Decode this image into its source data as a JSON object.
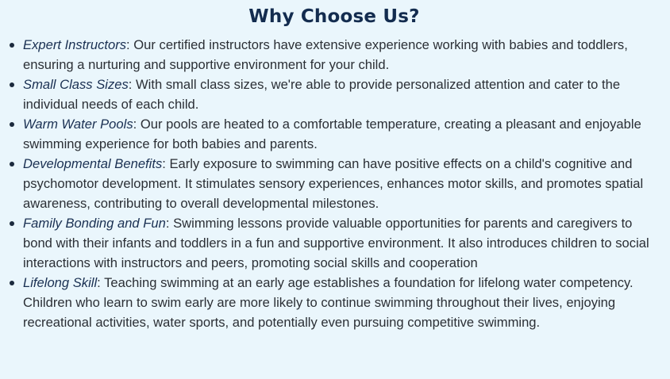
{
  "heading": "Why Choose Us?",
  "items": [
    {
      "term": "Expert Instructors",
      "text": ": Our certified instructors have extensive experience working with babies and toddlers, ensuring a nurturing and supportive environment for your child."
    },
    {
      "term": "Small Class Sizes",
      "text": ": With small class sizes, we're able to provide personalized attention and cater to the individual needs of each child."
    },
    {
      "term": "Warm Water Pools",
      "text": ": Our pools are heated to a comfortable temperature, creating a pleasant and enjoyable swimming experience for both babies and parents."
    },
    {
      "term": "Developmental Benefits",
      "text": ": Early exposure to swimming can have positive effects on a child's cognitive and psychomotor development. It stimulates sensory experiences, enhances motor skills, and promotes spatial awareness, contributing to overall developmental milestones."
    },
    {
      "term": "Family Bonding and Fun",
      "text": ": Swimming lessons provide valuable opportunities for parents and caregivers to bond with their infants and toddlers in a fun and supportive environment. It also introduces children to social interactions with instructors and peers, promoting social skills and cooperation"
    },
    {
      "term": "Lifelong Skill",
      "text": ": Teaching swimming at an early age establishes a foundation for lifelong water competency. Children who learn to swim early are more likely to continue swimming throughout their lives, enjoying recreational activities, water sports, and potentially even pursuing competitive swimming."
    }
  ]
}
